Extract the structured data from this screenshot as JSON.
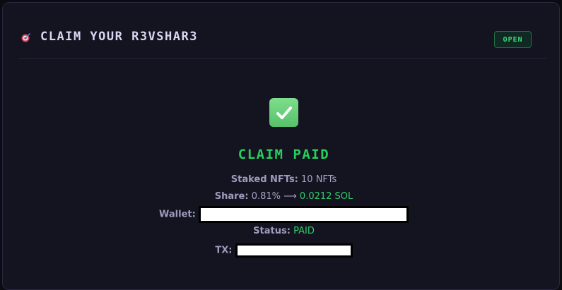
{
  "header": {
    "title": "CLAIM YOUR R3VSHAR3",
    "icon": "target-icon",
    "badge": "OPEN"
  },
  "result": {
    "icon": "check-mark-icon",
    "title": "CLAIM PAID",
    "staked_label": "Staked NFTs:",
    "staked_value": "10 NFTs",
    "share_label": "Share:",
    "share_percent": "0.81%",
    "share_arrow": "⟶",
    "share_amount": "0.0212 SOL",
    "wallet_label": "Wallet:",
    "status_label": "Status:",
    "status_value": "PAID",
    "tx_label": "TX:"
  },
  "colors": {
    "accent_green": "#25d05e",
    "badge_green": "#3fd27a",
    "background": "#141320"
  }
}
